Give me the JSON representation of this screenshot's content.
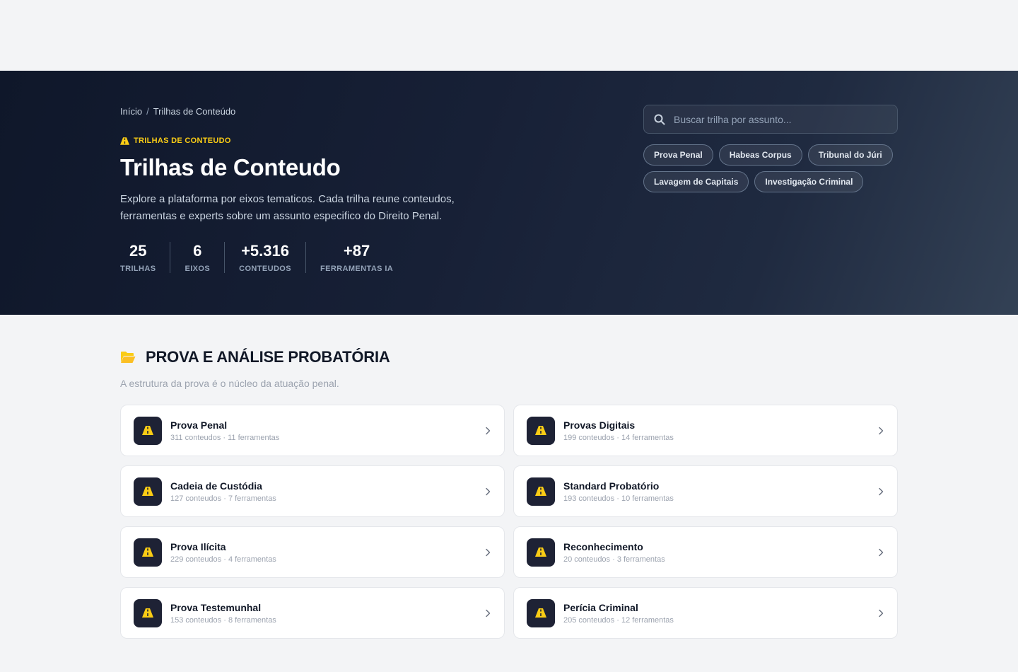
{
  "breadcrumb": {
    "home": "Início",
    "separator": "/",
    "current": "Trilhas de Conteúdo"
  },
  "hero": {
    "eyebrow": "TRILHAS DE CONTEUDO",
    "eyebrow_icon": "road-icon",
    "title": "Trilhas de Conteudo",
    "description": "Explore a plataforma por eixos tematicos. Cada trilha reune conteudos, ferramentas e experts sobre um assunto especifico do Direito Penal.",
    "stats": [
      {
        "value": "25",
        "label": "TRILHAS"
      },
      {
        "value": "6",
        "label": "EIXOS"
      },
      {
        "value": "+5.316",
        "label": "CONTEUDOS"
      },
      {
        "value": "+87",
        "label": "FERRAMENTAS IA"
      }
    ]
  },
  "search": {
    "placeholder": "Buscar trilha por assunto...",
    "value": "",
    "icon": "search-icon"
  },
  "tags": [
    "Prova Penal",
    "Habeas Corpus",
    "Tribunal do Júri",
    "Lavagem de Capitais",
    "Investigação Criminal"
  ],
  "section": {
    "icon": "folder-open-icon",
    "title": "PROVA E ANÁLISE PROBATÓRIA",
    "subtitle": "A estrutura da prova é o núcleo da atuação penal."
  },
  "trails": [
    {
      "name": "Prova Penal",
      "meta": "311 conteudos · 11 ferramentas"
    },
    {
      "name": "Provas Digitais",
      "meta": "199 conteudos · 14 ferramentas"
    },
    {
      "name": "Cadeia de Custódia",
      "meta": "127 conteudos · 7 ferramentas"
    },
    {
      "name": "Standard Probatório",
      "meta": "193 conteudos · 10 ferramentas"
    },
    {
      "name": "Prova Ilícita",
      "meta": "229 conteudos · 4 ferramentas"
    },
    {
      "name": "Reconhecimento",
      "meta": "20 conteudos · 3 ferramentas"
    },
    {
      "name": "Prova Testemunhal",
      "meta": "153 conteudos · 8 ferramentas"
    },
    {
      "name": "Perícia Criminal",
      "meta": "205 conteudos · 12 ferramentas"
    }
  ],
  "colors": {
    "accent": "#facc15",
    "hero_dark": "#0f172a",
    "card_icon_bg": "#1e2235"
  }
}
